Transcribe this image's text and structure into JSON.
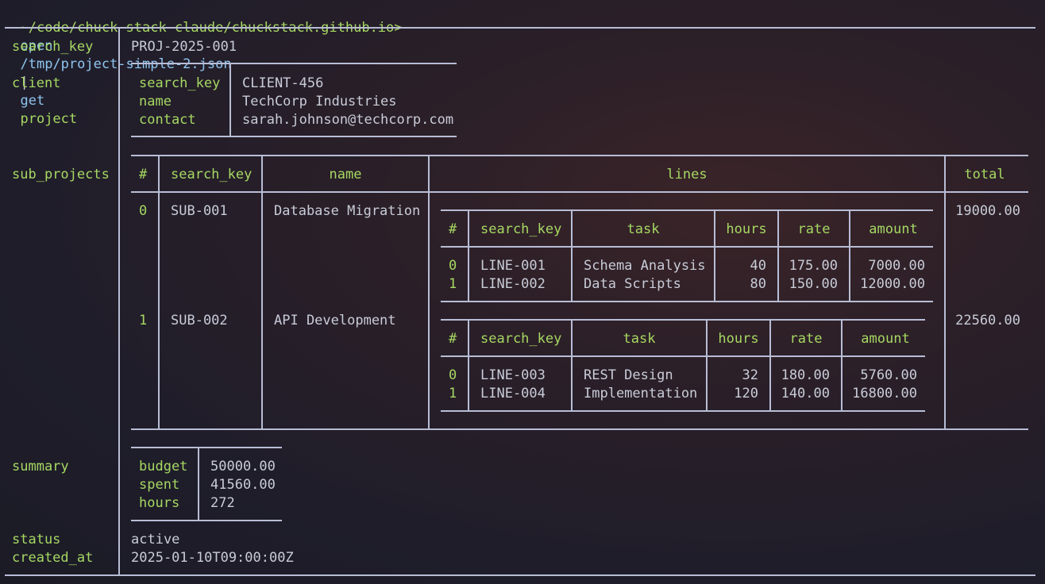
{
  "prompt": {
    "path": "~/code/chuck-stack-claude/chuckstack.github.io>",
    "command": "open",
    "argument": "/tmp/project-simple-2.json",
    "pipe": "|",
    "command2": "get",
    "argument2": "project"
  },
  "record": {
    "search_key_label": "search_key",
    "search_key_value": "PROJ-2025-001",
    "client_label": "client",
    "client": {
      "search_key_label": "search_key",
      "search_key_value": "CLIENT-456",
      "name_label": "name",
      "name_value": "TechCorp Industries",
      "contact_label": "contact",
      "contact_value": "sarah.johnson@techcorp.com"
    },
    "sub_projects_label": "sub_projects",
    "sub_projects_headers": {
      "index": "#",
      "search_key": "search_key",
      "name": "name",
      "lines": "lines",
      "total": "total"
    },
    "sub_projects": [
      {
        "index": "0",
        "search_key": "SUB-001",
        "name": "Database Migration",
        "total": "19000.00",
        "line_headers": {
          "index": "#",
          "search_key": "search_key",
          "task": "task",
          "hours": "hours",
          "rate": "rate",
          "amount": "amount"
        },
        "lines": [
          {
            "index": "0",
            "search_key": "LINE-001",
            "task": "Schema Analysis",
            "hours": "40",
            "rate": "175.00",
            "amount": "7000.00"
          },
          {
            "index": "1",
            "search_key": "LINE-002",
            "task": "Data Scripts",
            "hours": "80",
            "rate": "150.00",
            "amount": "12000.00"
          }
        ]
      },
      {
        "index": "1",
        "search_key": "SUB-002",
        "name": "API Development",
        "total": "22560.00",
        "line_headers": {
          "index": "#",
          "search_key": "search_key",
          "task": "task",
          "hours": "hours",
          "rate": "rate",
          "amount": "amount"
        },
        "lines": [
          {
            "index": "0",
            "search_key": "LINE-003",
            "task": "REST Design",
            "hours": "32",
            "rate": "180.00",
            "amount": "5760.00"
          },
          {
            "index": "1",
            "search_key": "LINE-004",
            "task": "Implementation",
            "hours": "120",
            "rate": "140.00",
            "amount": "16800.00"
          }
        ]
      }
    ],
    "summary_label": "summary",
    "summary": {
      "budget_label": "budget",
      "budget_value": "50000.00",
      "spent_label": "spent",
      "spent_value": "41560.00",
      "hours_label": "hours",
      "hours_value": "272"
    },
    "status_label": "status",
    "status_value": "active",
    "created_at_label": "created_at",
    "created_at_value": "2025-01-10T09:00:00Z"
  },
  "colors": {
    "key": "#a6d862",
    "command": "#8fc5f0",
    "text": "#c8ccd8",
    "border": "#b8bdd6"
  }
}
